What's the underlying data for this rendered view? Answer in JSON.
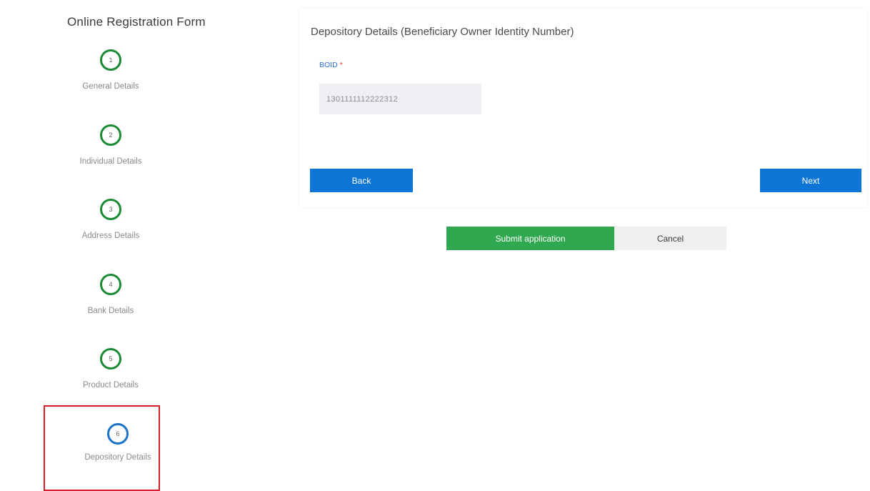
{
  "sidebar": {
    "title": "Online Registration Form",
    "steps": [
      {
        "number": "1",
        "label": "General Details",
        "status": "complete"
      },
      {
        "number": "2",
        "label": "Individual Details",
        "status": "complete"
      },
      {
        "number": "3",
        "label": "Address Details",
        "status": "complete"
      },
      {
        "number": "4",
        "label": "Bank Details",
        "status": "complete"
      },
      {
        "number": "5",
        "label": "Product Details",
        "status": "complete"
      },
      {
        "number": "6",
        "label": "Depository Details",
        "status": "active"
      }
    ]
  },
  "form": {
    "title": "Depository Details (Beneficiary Owner Identity Number)",
    "boid_label": "BOID",
    "required_mark": "*",
    "boid_value": "1301111112222312",
    "back_label": "Back",
    "next_label": "Next"
  },
  "actions": {
    "submit_label": "Submit application",
    "cancel_label": "Cancel"
  },
  "colors": {
    "complete": "#1a8a35",
    "active": "#1e73c9",
    "primary_button": "#0c75d6",
    "submit_button": "#2fa84f",
    "highlight_box": "#d61f26"
  }
}
